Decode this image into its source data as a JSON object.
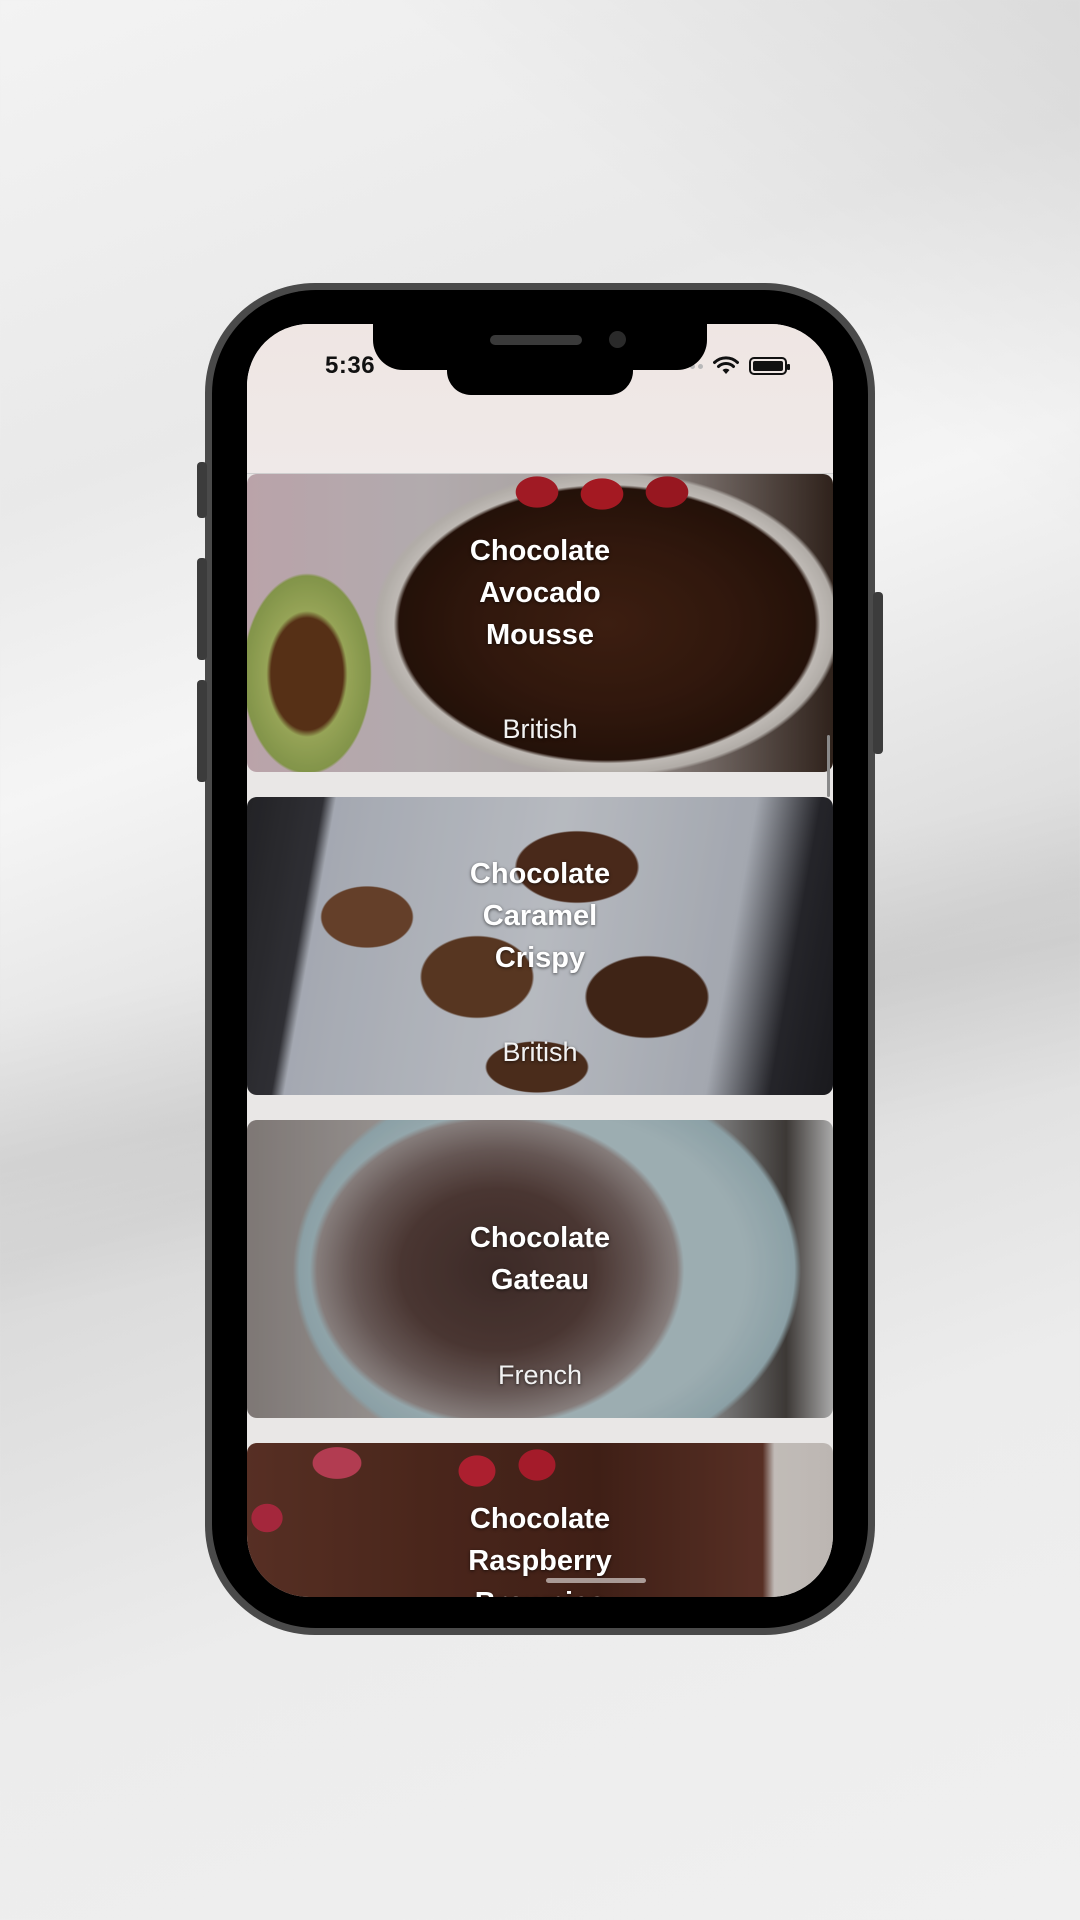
{
  "status_bar": {
    "time": "5:36",
    "icons": [
      "signal-dots-icon",
      "wifi-icon",
      "battery-icon"
    ]
  },
  "recipes": [
    {
      "title_lines": [
        "Chocolate",
        "Avocado",
        "Mousse"
      ],
      "area": "British"
    },
    {
      "title_lines": [
        "Chocolate",
        "Caramel",
        "Crispy"
      ],
      "area": "British"
    },
    {
      "title_lines": [
        "Chocolate",
        "Gateau"
      ],
      "area": "French"
    },
    {
      "title_lines": [
        "Chocolate",
        "Raspberry",
        "Brownies"
      ],
      "area": ""
    }
  ]
}
